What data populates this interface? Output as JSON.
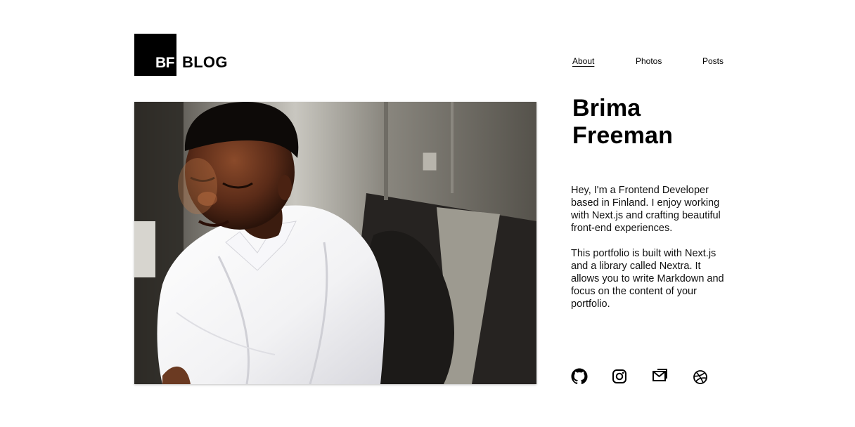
{
  "header": {
    "logo_initials": "BF",
    "logo_text": "BLOG",
    "nav": [
      {
        "label": "About",
        "active": true
      },
      {
        "label": "Photos",
        "active": false
      },
      {
        "label": "Posts",
        "active": false
      }
    ]
  },
  "profile": {
    "name_line1": "Brima",
    "name_line2": "Freeman",
    "bio": [
      "Hey, I'm a Frontend Developer based in Finland. I enjoy working with Next.js and crafting beautiful front-end experiences.",
      "This portfolio is built with Next.js and a library called Nextra. It allows you to write Markdown and focus on the content of your portfolio."
    ]
  },
  "socials": [
    {
      "icon": "github-icon"
    },
    {
      "icon": "instagram-icon"
    },
    {
      "icon": "mail-icon"
    },
    {
      "icon": "dribbble-icon"
    }
  ],
  "colors": {
    "text": "#000000",
    "background": "#ffffff",
    "logo_bg": "#000000"
  }
}
